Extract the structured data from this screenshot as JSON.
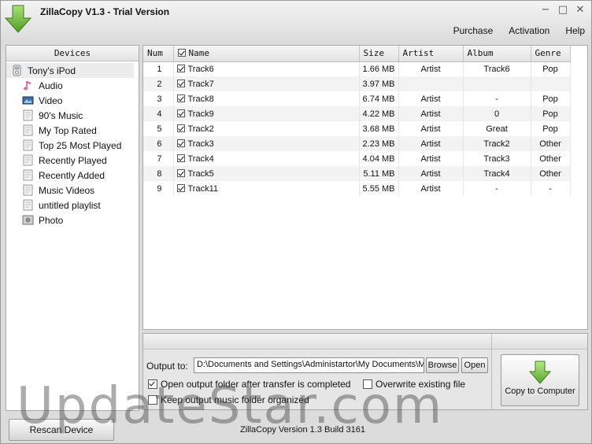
{
  "window": {
    "title": "ZillaCopy V1.3  - Trial Version",
    "minimize_glyph": "−",
    "maximize_glyph": "□",
    "close_glyph": "✕"
  },
  "menu": {
    "items": [
      "Purchase",
      "Activation",
      "Help"
    ]
  },
  "devices": {
    "header": "Devices",
    "root": {
      "label": "Tony's iPod",
      "icon": "ipod-icon"
    },
    "items": [
      {
        "label": "Audio",
        "icon": "music-note-icon"
      },
      {
        "label": "Video",
        "icon": "video-icon"
      },
      {
        "label": "90's Music",
        "icon": "playlist-icon"
      },
      {
        "label": "My Top Rated",
        "icon": "playlist-icon"
      },
      {
        "label": "Top 25 Most Played",
        "icon": "playlist-icon"
      },
      {
        "label": "Recently Played",
        "icon": "playlist-icon"
      },
      {
        "label": "Recently Added",
        "icon": "playlist-icon"
      },
      {
        "label": "Music Videos",
        "icon": "playlist-icon"
      },
      {
        "label": "untitled playlist",
        "icon": "playlist-icon"
      },
      {
        "label": "Photo",
        "icon": "photo-icon"
      }
    ]
  },
  "tracks": {
    "columns": {
      "num": "Num",
      "name": "Name",
      "size": "Size",
      "artist": "Artist",
      "album": "Album",
      "genre": "Genre"
    },
    "header_checked": true,
    "rows": [
      {
        "num": "1",
        "checked": true,
        "name": "Track6",
        "size": "1.66 MB",
        "artist": "Artist",
        "album": "Track6",
        "genre": "Pop"
      },
      {
        "num": "2",
        "checked": true,
        "name": "Track7",
        "size": "3.97 MB",
        "artist": "",
        "album": "",
        "genre": ""
      },
      {
        "num": "3",
        "checked": true,
        "name": "Track8",
        "size": "6.74 MB",
        "artist": "Artist",
        "album": "-",
        "genre": "Pop"
      },
      {
        "num": "4",
        "checked": true,
        "name": "Track9",
        "size": "4.22 MB",
        "artist": "Artist",
        "album": "0",
        "genre": "Pop"
      },
      {
        "num": "5",
        "checked": true,
        "name": "Track2",
        "size": "3.68 MB",
        "artist": "Artist",
        "album": "Great",
        "genre": "Pop"
      },
      {
        "num": "6",
        "checked": true,
        "name": "Track3",
        "size": "2.23 MB",
        "artist": "Artist",
        "album": "Track2",
        "genre": "Other"
      },
      {
        "num": "7",
        "checked": true,
        "name": "Track4",
        "size": "4.04 MB",
        "artist": "Artist",
        "album": "Track3",
        "genre": "Other"
      },
      {
        "num": "8",
        "checked": true,
        "name": "Track5",
        "size": "5.11 MB",
        "artist": "Artist",
        "album": "Track4",
        "genre": "Other"
      },
      {
        "num": "9",
        "checked": true,
        "name": "Track11",
        "size": "5.55 MB",
        "artist": "Artist",
        "album": "-",
        "genre": "-"
      }
    ]
  },
  "output": {
    "label": "Output to:",
    "path": "D:\\Documents and Settings\\Administartor\\My Documents\\M",
    "browse_label": "Browse",
    "open_label": "Open",
    "open_after_label": "Open output folder after transfer is completed",
    "open_after_checked": true,
    "overwrite_label": "Overwrite existing file",
    "overwrite_checked": false,
    "keep_organized_label": "Keep output music folder organized",
    "keep_organized_checked": false,
    "copy_label": "Copy to Computer"
  },
  "footer": {
    "rescan_label": "Rescan Device",
    "status": "ZillaCopy Version 1.3 Build 3161"
  },
  "watermark": "UpdateStar.com",
  "colors": {
    "accent_green": "#6fbf3a",
    "selection": "#ececec"
  }
}
